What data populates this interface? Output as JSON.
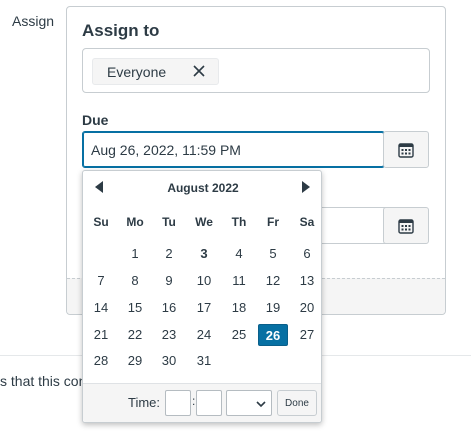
{
  "side_label": "Assign",
  "assign_card": {
    "heading": "Assign to",
    "tokens": [
      {
        "label": "Everyone"
      }
    ],
    "due_label": "Due",
    "due_value": "Aug 26, 2022, 11:59 PM"
  },
  "cut_text": "s that this con",
  "datepicker": {
    "month_title": "August 2022",
    "weekdays": [
      "Su",
      "Mo",
      "Tu",
      "We",
      "Th",
      "Fr",
      "Sa"
    ],
    "weeks": [
      [
        "",
        "1",
        "2",
        "3",
        "4",
        "5",
        "6"
      ],
      [
        "7",
        "8",
        "9",
        "10",
        "11",
        "12",
        "13"
      ],
      [
        "14",
        "15",
        "16",
        "17",
        "18",
        "19",
        "20"
      ],
      [
        "21",
        "22",
        "23",
        "24",
        "25",
        "26",
        "27"
      ],
      [
        "28",
        "29",
        "30",
        "31",
        "",
        "",
        ""
      ]
    ],
    "today": "3",
    "selected": "26",
    "time_label": "Time:",
    "time_separator": ":",
    "done_label": "Done"
  },
  "colors": {
    "accent": "#0770a3",
    "text": "#2d3b45",
    "border": "#c7cdd1"
  },
  "icons": [
    "remove-x-icon",
    "calendar-icon",
    "prev-month-icon",
    "next-month-icon",
    "chevron-down-icon"
  ]
}
